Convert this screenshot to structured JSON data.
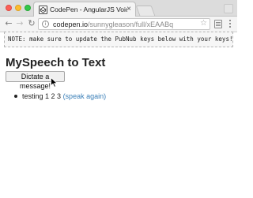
{
  "browser": {
    "tab_title": "CodePen - AngularJS Voice D",
    "tab_close": "×",
    "url_host": "codepen.io",
    "url_path": "/sunnygleason/full/xEAABq",
    "accent_colors": {
      "close": "#fc5f57",
      "minimize": "#fdbc2e",
      "maximize": "#33c748"
    },
    "icons": {
      "back": "←",
      "forward": "→",
      "reload": "↻",
      "info": "i",
      "star": "☆"
    }
  },
  "page": {
    "notice": "NOTE: make sure to update the PubNub keys below with your keys!",
    "heading": "MySpeech to Text",
    "dictate_button": "Dictate a message!",
    "results": [
      {
        "text": "testing 1 2 3",
        "link": "(speak again)"
      }
    ],
    "link_color": "#3a7fb8"
  }
}
